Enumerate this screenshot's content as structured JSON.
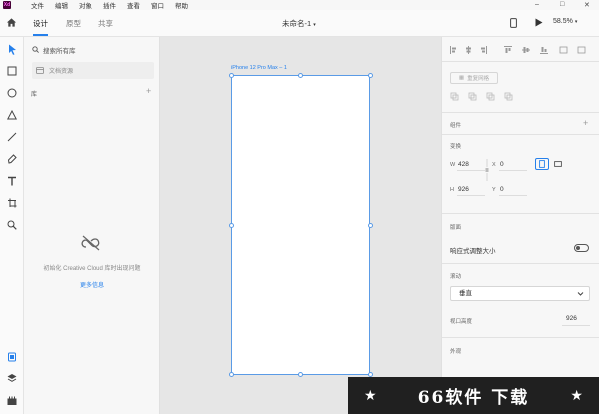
{
  "menubar": {
    "logo": "Xd",
    "items": [
      "文件",
      "编辑",
      "对象",
      "插件",
      "查看",
      "窗口",
      "帮助"
    ]
  },
  "tabbar": {
    "tabs": [
      "设计",
      "原型",
      "共享"
    ],
    "document_title": "未命名-1",
    "zoom": "58.5%"
  },
  "libraries": {
    "search_placeholder": "搜索所有库",
    "document_assets": "文档资源",
    "header": "库",
    "add": "+",
    "cc_message": "初始化 Creative Cloud 库时出现问题",
    "more_info": "更多信息"
  },
  "canvas": {
    "artboard_label": "iPhone 12 Pro Max – 1"
  },
  "inspector": {
    "repeat_grid": "重复网格",
    "components_label": "组件",
    "components_add": "+",
    "transform_label": "变换",
    "w_label": "W",
    "w_value": "428",
    "x_label": "X",
    "x_value": "0",
    "h_label": "H",
    "h_value": "926",
    "y_label": "Y",
    "y_value": "0",
    "layout_label": "版面",
    "responsive_resize": "响应式调整大小",
    "scroll_label": "滚动",
    "scroll_value": "垂直",
    "viewport_height_label": "视口高度",
    "viewport_height_value": "926",
    "appearance_label": "外观"
  },
  "watermark": {
    "text": "66软件 下载",
    "star": "★"
  },
  "colors": {
    "accent": "#2680eb",
    "logo_bg": "#470137",
    "logo_fg": "#ff61f6"
  }
}
